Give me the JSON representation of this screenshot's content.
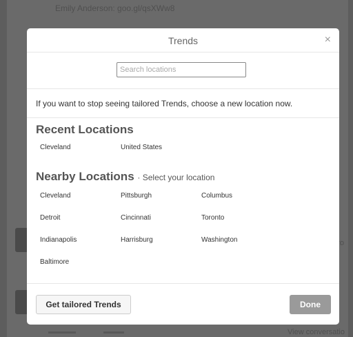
{
  "background": {
    "top_text": "Emily Anderson: goo.gl/qsXWw8",
    "side_text": "ro",
    "view_link": "View conversatio"
  },
  "modal": {
    "title": "Trends",
    "close_glyph": "×",
    "search": {
      "placeholder": "Search locations",
      "value": ""
    },
    "info": "If you want to stop seeing tailored Trends, choose a new location now.",
    "recent": {
      "title": "Recent Locations",
      "items": [
        "Cleveland",
        "United States"
      ]
    },
    "nearby": {
      "title": "Nearby Locations",
      "subtitle": "· Select your location",
      "items": [
        "Cleveland",
        "Pittsburgh",
        "Columbus",
        "Detroit",
        "Cincinnati",
        "Toronto",
        "Indianapolis",
        "Harrisburg",
        "Washington",
        "Baltimore"
      ]
    },
    "buttons": {
      "tailored": "Get tailored Trends",
      "done": "Done"
    }
  },
  "icons": {
    "close": "close-icon"
  }
}
